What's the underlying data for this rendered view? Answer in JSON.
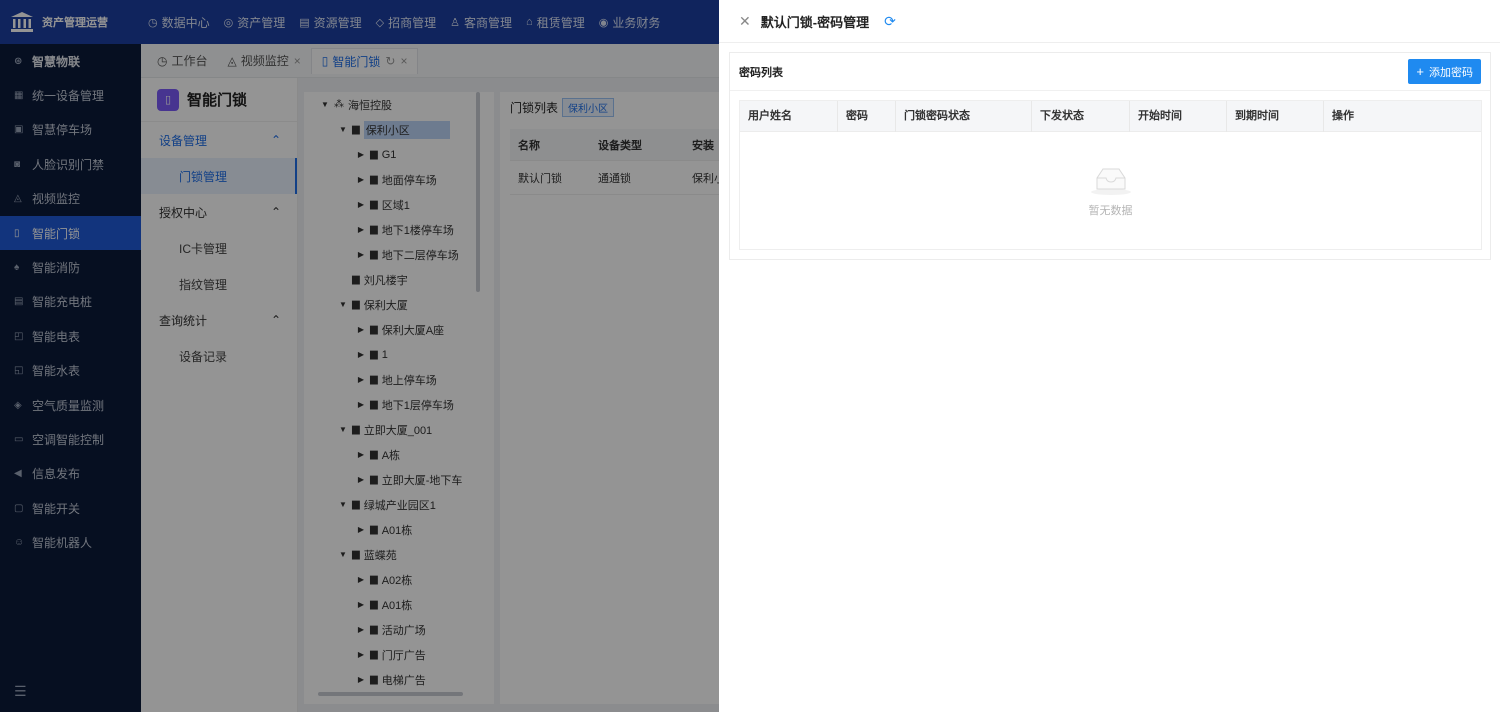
{
  "app": {
    "logo_text": "资产管理运营"
  },
  "topnav": [
    {
      "icon": "◷",
      "label": "数据中心"
    },
    {
      "icon": "◎",
      "label": "资产管理"
    },
    {
      "icon": "▤",
      "label": "资源管理"
    },
    {
      "icon": "◇",
      "label": "招商管理"
    },
    {
      "icon": "♙",
      "label": "客商管理"
    },
    {
      "icon": "⌂",
      "label": "租赁管理"
    },
    {
      "icon": "◉",
      "label": "业务财务"
    }
  ],
  "sidebar": {
    "items": [
      {
        "icon": "⊛",
        "label": "智慧物联"
      },
      {
        "icon": "▦",
        "label": "统一设备管理"
      },
      {
        "icon": "▣",
        "label": "智慧停车场"
      },
      {
        "icon": "◙",
        "label": "人脸识别门禁"
      },
      {
        "icon": "◬",
        "label": "视频监控"
      },
      {
        "icon": "▯",
        "label": "智能门锁"
      },
      {
        "icon": "♠",
        "label": "智能消防"
      },
      {
        "icon": "▤",
        "label": "智能充电桩"
      },
      {
        "icon": "◰",
        "label": "智能电表"
      },
      {
        "icon": "◱",
        "label": "智能水表"
      },
      {
        "icon": "◈",
        "label": "空气质量监测"
      },
      {
        "icon": "▭",
        "label": "空调智能控制"
      },
      {
        "icon": "◀",
        "label": "信息发布"
      },
      {
        "icon": "▢",
        "label": "智能开关"
      },
      {
        "icon": "☺",
        "label": "智能机器人"
      }
    ],
    "collapse_icon": "☰"
  },
  "tabs": [
    {
      "icon": "◷",
      "label": "工作台"
    },
    {
      "icon": "◬",
      "label": "视频监控"
    },
    {
      "icon": "▯",
      "label": "智能门锁"
    }
  ],
  "submenu": {
    "title": "智能门锁",
    "groups": [
      {
        "label": "设备管理",
        "items": [
          "门锁管理"
        ]
      },
      {
        "label": "授权中心",
        "items": [
          "IC卡管理",
          "指纹管理"
        ]
      },
      {
        "label": "查询统计",
        "items": [
          "设备记录"
        ]
      }
    ]
  },
  "tree": [
    "海恒控股",
    "保利小区",
    "G1",
    "地面停车场",
    "区域1",
    "地下1楼停车场",
    "地下二层停车场",
    "刘凡楼宇",
    "保利大厦",
    "保利大厦A座",
    "1",
    "地上停车场",
    "地下1层停车场",
    "立即大厦_001",
    "A栋",
    "立即大厦-地下车",
    "绿城产业园区1",
    "A01栋",
    "蓝蝶苑",
    "A02栋",
    "A01栋",
    "活动广场",
    "门厅广告",
    "电梯广告"
  ],
  "lock_panel": {
    "title": "门锁列表",
    "tag": "保利小区",
    "columns": [
      "名称",
      "设备类型",
      "安装"
    ],
    "rows": [
      [
        "默认门锁",
        "通通锁",
        "保利小"
      ]
    ]
  },
  "drawer": {
    "title": "默认门锁-密码管理",
    "card_title": "密码列表",
    "add_button": "添加密码",
    "columns": [
      "用户姓名",
      "密码",
      "门锁密码状态",
      "下发状态",
      "开始时间",
      "到期时间",
      "操作"
    ],
    "empty_text": "暂无数据"
  }
}
